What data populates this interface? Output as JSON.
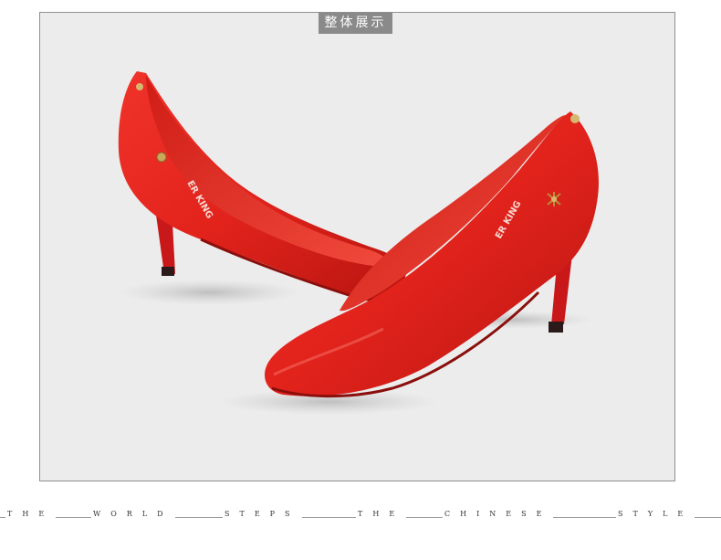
{
  "header": {
    "title": "整体展示"
  },
  "footer": {
    "words": [
      "THE",
      "WORLD",
      "STEPS",
      "THE",
      "CHINESE",
      "STYLE"
    ]
  },
  "product": {
    "insole_brand": "ER KING",
    "color": "#e8231e"
  }
}
